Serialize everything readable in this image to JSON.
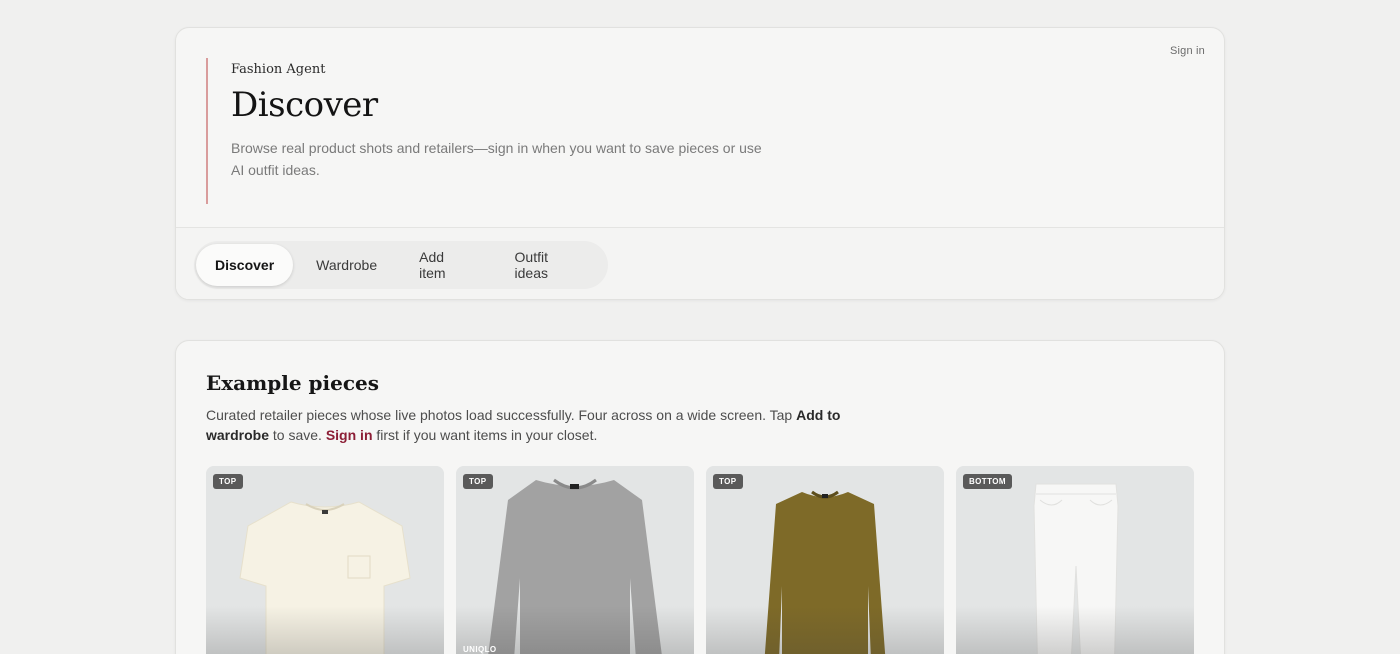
{
  "header": {
    "sign_in": "Sign in",
    "brand": "Fashion Agent",
    "title": "Discover",
    "subtitle": "Browse real product shots and retailers—sign in when you want to save pieces or use AI outfit ideas."
  },
  "tabs": [
    {
      "label": "Discover",
      "active": true
    },
    {
      "label": "Wardrobe",
      "active": false
    },
    {
      "label": "Add item",
      "active": false
    },
    {
      "label": "Outfit ideas",
      "active": false
    }
  ],
  "section": {
    "title": "Example pieces",
    "desc_part1": "Curated retailer pieces whose live photos load successfully. Four across on a wide screen. Tap ",
    "desc_bold": "Add to wardrobe",
    "desc_part2": " to save. ",
    "desc_link": "Sign in",
    "desc_part3": " first if you want items in your closet."
  },
  "products": [
    {
      "category": "TOP",
      "brand": "",
      "image": "cream t-shirt"
    },
    {
      "category": "TOP",
      "brand": "UNIQLO",
      "image": "grey crewneck sweater"
    },
    {
      "category": "TOP",
      "brand": "",
      "image": "olive crewneck sweater"
    },
    {
      "category": "BOTTOM",
      "brand": "",
      "image": "white jeans"
    }
  ],
  "colors": {
    "accent": "#8c1e36",
    "hero_rule": "#d99c9c",
    "background": "#f0f0ef"
  }
}
